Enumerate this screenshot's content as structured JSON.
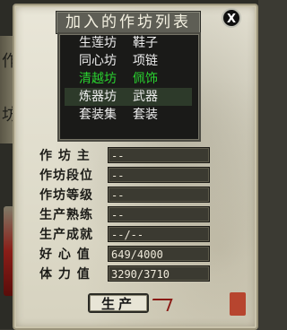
{
  "window": {
    "title": "加入的作坊列表",
    "close_label": "X",
    "left_strip_chars": [
      "作",
      "坊"
    ]
  },
  "list": {
    "rows": [
      {
        "name": "生莲坊",
        "item": "鞋子",
        "state": "normal"
      },
      {
        "name": "同心坊",
        "item": "项链",
        "state": "normal"
      },
      {
        "name": "清越坊",
        "item": "佩饰",
        "state": "highlight"
      },
      {
        "name": "炼器坊",
        "item": "武器",
        "state": "selected"
      },
      {
        "name": "套装集",
        "item": "套装",
        "state": "normal"
      }
    ]
  },
  "stats": [
    {
      "label": "作 坊 主",
      "value": "--"
    },
    {
      "label": "作坊段位",
      "value": "--"
    },
    {
      "label": "作坊等级",
      "value": "--"
    },
    {
      "label": "生产熟练",
      "value": "--"
    },
    {
      "label": "生产成就",
      "value": "--/--"
    },
    {
      "label": "好 心 值",
      "value": "649/4000"
    },
    {
      "label": "体 力 值",
      "value": "3290/3710"
    }
  ],
  "actions": {
    "produce_label": "生产"
  },
  "colors": {
    "highlight_text": "#29d12f",
    "row_text": "#eeeeee",
    "parchment": "#e9e6d8"
  }
}
